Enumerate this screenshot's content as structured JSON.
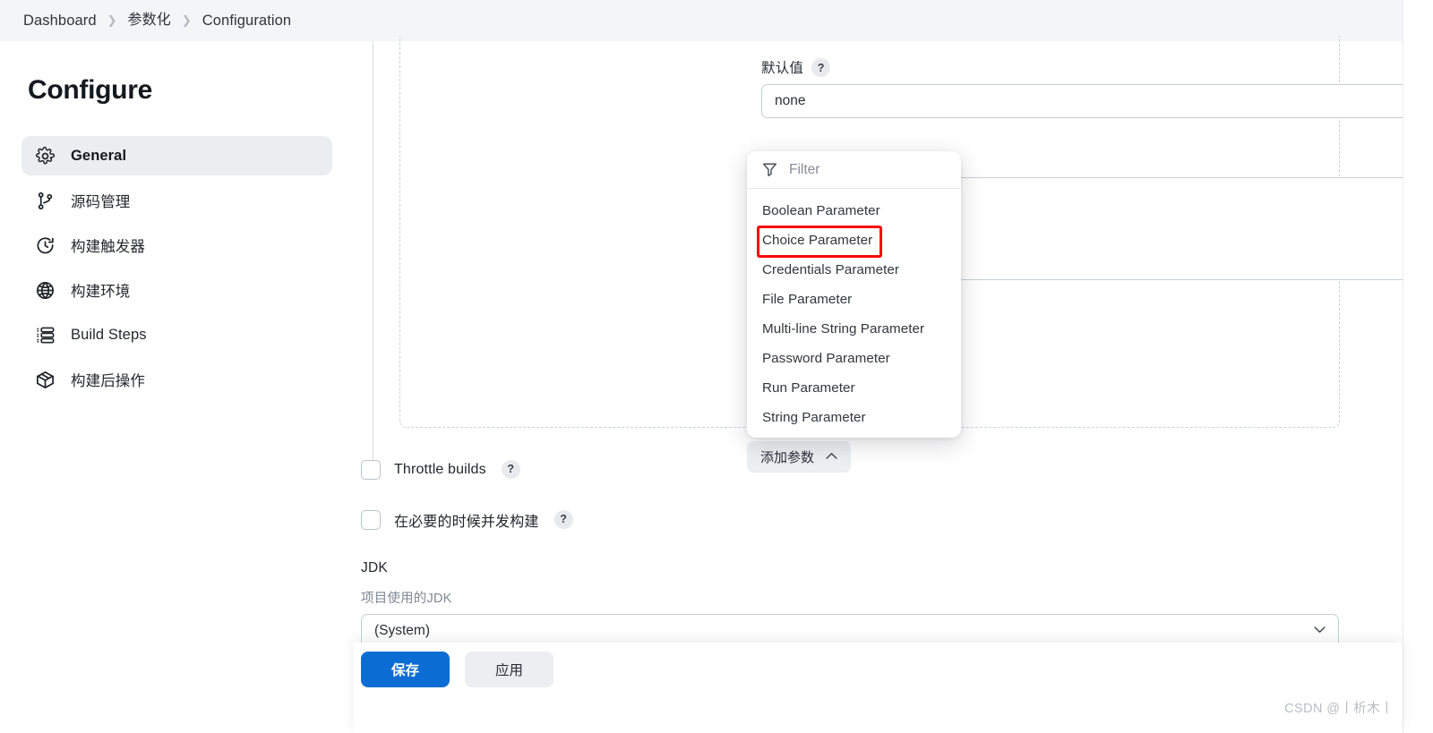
{
  "breadcrumb": {
    "items": [
      {
        "label": "Dashboard"
      },
      {
        "label": "参数化"
      },
      {
        "label": "Configuration"
      }
    ],
    "separator": "❯"
  },
  "sidebar": {
    "title": "Configure",
    "items": [
      {
        "label": "General",
        "icon": "gear-icon",
        "active": true
      },
      {
        "label": "源码管理",
        "icon": "branch-icon",
        "active": false
      },
      {
        "label": "构建触发器",
        "icon": "clock-icon",
        "active": false
      },
      {
        "label": "构建环境",
        "icon": "globe-icon",
        "active": false
      },
      {
        "label": "Build Steps",
        "icon": "list-steps-icon",
        "active": false
      },
      {
        "label": "构建后操作",
        "icon": "package-icon",
        "active": false
      }
    ]
  },
  "parameter_block": {
    "default_value": {
      "label": "默认值",
      "help": "?",
      "value": "none",
      "placeholder": ""
    },
    "description_area": {
      "value": "",
      "placeholder": ""
    }
  },
  "add_parameter": {
    "label": "添加参数",
    "chevron": "⌃"
  },
  "dropdown": {
    "filter": {
      "placeholder": "Filter",
      "value": "",
      "icon": "filter-icon"
    },
    "items": [
      {
        "label": "Boolean Parameter",
        "highlighted": false
      },
      {
        "label": "Choice Parameter",
        "highlighted": true
      },
      {
        "label": "Credentials Parameter",
        "highlighted": false
      },
      {
        "label": "File Parameter",
        "highlighted": false
      },
      {
        "label": "Multi-line String Parameter",
        "highlighted": false
      },
      {
        "label": "Password Parameter",
        "highlighted": false
      },
      {
        "label": "Run Parameter",
        "highlighted": false
      },
      {
        "label": "String Parameter",
        "highlighted": false
      }
    ]
  },
  "checkboxes": [
    {
      "label": "Throttle builds",
      "help": "?",
      "checked": false
    },
    {
      "label": "在必要的时候并发构建",
      "help": "?",
      "checked": false
    }
  ],
  "jdk": {
    "title": "JDK",
    "description": "项目使用的JDK",
    "selected": "(System)",
    "caret": "⌄"
  },
  "actions": {
    "save_label": "保存",
    "apply_label": "应用"
  },
  "watermark": "CSDN @丨析木丨",
  "colors": {
    "accent_blue": "#0b6dd4",
    "header_bg": "#f4f5f7",
    "active_item_bg": "#ebedf0",
    "annotation_red": "#fb0606",
    "muted_text": "#7e8894"
  }
}
